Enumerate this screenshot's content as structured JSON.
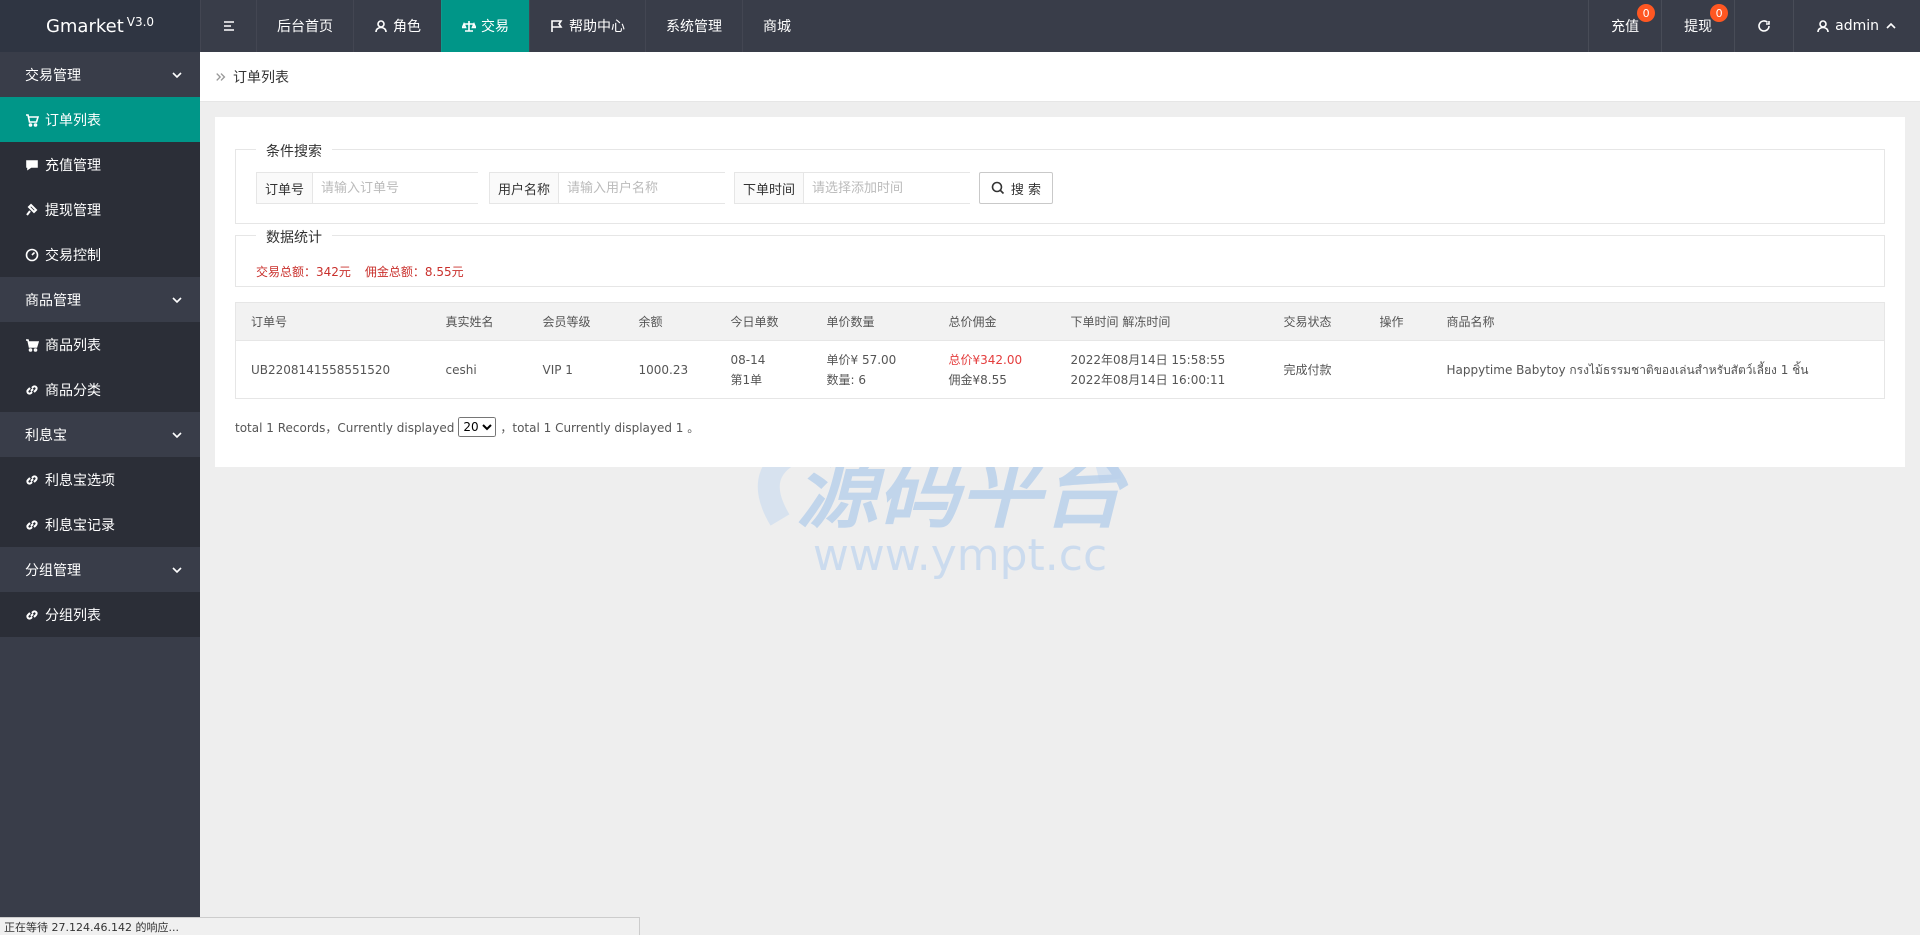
{
  "header": {
    "logo": "Gmarket",
    "version": "V3.0",
    "nav": [
      {
        "label": "后台首页"
      },
      {
        "label": "角色"
      },
      {
        "label": "交易"
      },
      {
        "label": "帮助中心"
      },
      {
        "label": "系统管理"
      },
      {
        "label": "商城"
      }
    ],
    "recharge": {
      "label": "充值",
      "badge": "0"
    },
    "withdraw": {
      "label": "提现",
      "badge": "0"
    },
    "user": "admin"
  },
  "sidebar": {
    "groups": [
      {
        "title": "交易管理",
        "items": [
          "订单列表",
          "充值管理",
          "提现管理",
          "交易控制"
        ]
      },
      {
        "title": "商品管理",
        "items": [
          "商品列表",
          "商品分类"
        ]
      },
      {
        "title": "利息宝",
        "items": [
          "利息宝选项",
          "利息宝记录"
        ]
      },
      {
        "title": "分组管理",
        "items": [
          "分组列表"
        ]
      }
    ]
  },
  "breadcrumb": "订单列表",
  "search": {
    "legend": "条件搜索",
    "order_label": "订单号",
    "order_placeholder": "请输入订单号",
    "user_label": "用户名称",
    "user_placeholder": "请输入用户名称",
    "time_label": "下单时间",
    "time_placeholder": "请选择添加时间",
    "button": "搜 索"
  },
  "stats": {
    "legend": "数据统计",
    "total_trade": "交易总额：342元",
    "total_commission": "佣金总额：8.55元"
  },
  "table": {
    "headers": [
      "订单号",
      "真实姓名",
      "会员等级",
      "余额",
      "今日单数",
      "单价数量",
      "总价佣金",
      "下单时间 解冻时间",
      "交易状态",
      "操作",
      "商品名称"
    ],
    "rows": [
      {
        "order_no": "UB2208141558551520",
        "name": "ceshi",
        "level": "VIP 1",
        "balance": "1000.23",
        "today_date": "08-14",
        "today_count": "第1单",
        "unit_price": "单价¥  57.00",
        "quantity": "数量:  6",
        "total_price": "总价¥342.00",
        "commission": "佣金¥8.55",
        "order_time": "2022年08月14日 15:58:55",
        "unfreeze_time": "2022年08月14日 16:00:11",
        "status": "完成付款",
        "action": "",
        "product": "Happytime Babytoy กรงไม้ธรรมชาติของเล่นสำหรับสัตว์เลี้ยง 1 ชิ้น"
      }
    ]
  },
  "pager": {
    "prefix": "total 1 Records，Currently displayed",
    "page_size": "20",
    "suffix": "，total 1 Currently displayed 1 。"
  },
  "watermark": {
    "main": "源码平台",
    "url": "www.ympt.cc"
  },
  "statusbar": "正在等待 27.124.46.142 的响应...",
  "colors": {
    "accent": "#009688",
    "sidebar": "#393d49",
    "highlight": "#e43d3d"
  }
}
